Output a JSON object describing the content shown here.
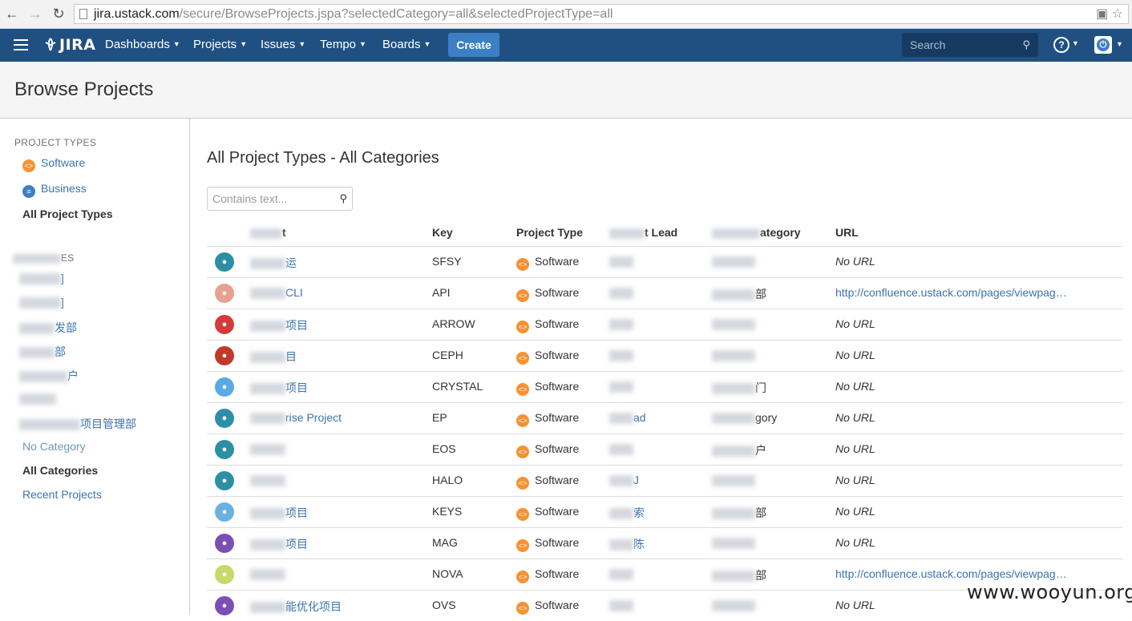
{
  "browser": {
    "url_host": "jira.ustack.com",
    "url_path": "/secure/BrowseProjects.jspa?selectedCategory=all&selectedProjectType=all"
  },
  "header": {
    "logo": "JIRA",
    "menus": [
      "Dashboards",
      "Projects",
      "Issues",
      "Tempo",
      "Boards"
    ],
    "create_label": "Create",
    "search_placeholder": "Search"
  },
  "page": {
    "title": "Browse Projects"
  },
  "sidebar": {
    "types_heading": "PROJECT TYPES",
    "types": [
      {
        "label": "Software",
        "icon": "software-icon"
      },
      {
        "label": "Business",
        "icon": "business-icon"
      }
    ],
    "all_types_label": "All Project Types",
    "categories_heading_tail": "ES",
    "categories": [
      "]",
      "]",
      "发部",
      "部",
      "户",
      "",
      "项目管理部",
      "No Category"
    ],
    "all_categories_label": "All Categories",
    "recent_label": "Recent Projects"
  },
  "main": {
    "title": "All Project Types - All Categories",
    "filter_placeholder": "Contains text...",
    "columns": {
      "project": "t",
      "key": "Key",
      "type": "Project Type",
      "lead": "t Lead",
      "category": "ategory",
      "url": "URL"
    },
    "rows": [
      {
        "name": "运",
        "key": "SFSY",
        "type": "Software",
        "lead": "",
        "category": "",
        "url": "No URL",
        "avatar_color": "#2d8fa6"
      },
      {
        "name": "CLI",
        "key": "API",
        "type": "Software",
        "lead": "",
        "category": "部",
        "url": "http://confluence.ustack.com/pages/viewpag…",
        "avatar_color": "#e8a090"
      },
      {
        "name": "项目",
        "key": "ARROW",
        "type": "Software",
        "lead": "",
        "category": "",
        "url": "No URL",
        "avatar_color": "#d33b3b"
      },
      {
        "name": "目",
        "key": "CEPH",
        "type": "Software",
        "lead": "",
        "category": "",
        "url": "No URL",
        "avatar_color": "#c0392b"
      },
      {
        "name": "项目",
        "key": "CRYSTAL",
        "type": "Software",
        "lead": "",
        "category": "门",
        "url": "No URL",
        "avatar_color": "#5aa9e6"
      },
      {
        "name": "rise Project",
        "key": "EP",
        "type": "Software",
        "lead": "ad",
        "category": "gory",
        "url": "No URL",
        "avatar_color": "#2d8fa6"
      },
      {
        "name": "",
        "key": "EOS",
        "type": "Software",
        "lead": "",
        "category": "户",
        "url": "No URL",
        "avatar_color": "#2d8fa6"
      },
      {
        "name": "",
        "key": "HALO",
        "type": "Software",
        "lead": "J",
        "category": "",
        "url": "No URL",
        "avatar_color": "#2d8fa6"
      },
      {
        "name": "项目",
        "key": "KEYS",
        "type": "Software",
        "lead": "索",
        "category": "部",
        "url": "No URL",
        "avatar_color": "#6ab0e0"
      },
      {
        "name": "项目",
        "key": "MAG",
        "type": "Software",
        "lead": "陈",
        "category": "",
        "url": "No URL",
        "avatar_color": "#7b4fb5"
      },
      {
        "name": "",
        "key": "NOVA",
        "type": "Software",
        "lead": "",
        "category": "部",
        "url": "http://confluence.ustack.com/pages/viewpag…",
        "avatar_color": "#c8d86a"
      },
      {
        "name": "能优化项目",
        "key": "OVS",
        "type": "Software",
        "lead": "",
        "category": "",
        "url": "No URL",
        "avatar_color": "#7b4fb5"
      }
    ]
  },
  "watermark": "www.wooyun.org"
}
